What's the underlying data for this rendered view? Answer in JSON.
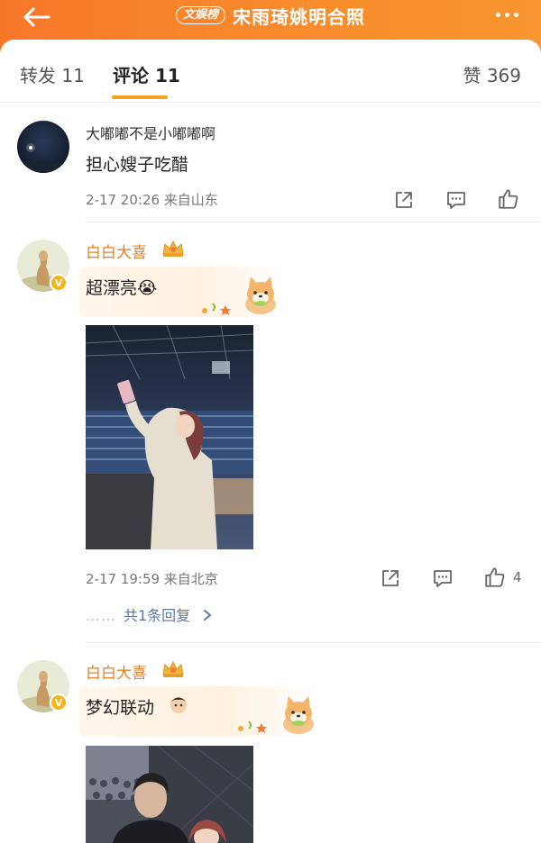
{
  "header": {
    "badge": "文娱榜",
    "title": "宋雨琦姚明合照",
    "colors": {
      "start": "#f7772a",
      "end": "#f8962f"
    }
  },
  "tabs": {
    "repost": "转发 11",
    "comment": "评论 11",
    "likes": "赞 369",
    "accent": "#f7a01e"
  },
  "comments": [
    {
      "username": "大嘟嘟不是小嘟嘟啊",
      "text": "担心嫂子吃醋",
      "meta": "2-17 20:26  来自山东"
    },
    {
      "username": "白白大喜",
      "text": "超漂亮",
      "emoji": "😭",
      "meta": "2-17 19:59  来自北京",
      "like_count": "4",
      "replies": "共1条回复",
      "reply_dots": "……"
    },
    {
      "username": "白白大喜",
      "text": "梦幻联动"
    }
  ]
}
